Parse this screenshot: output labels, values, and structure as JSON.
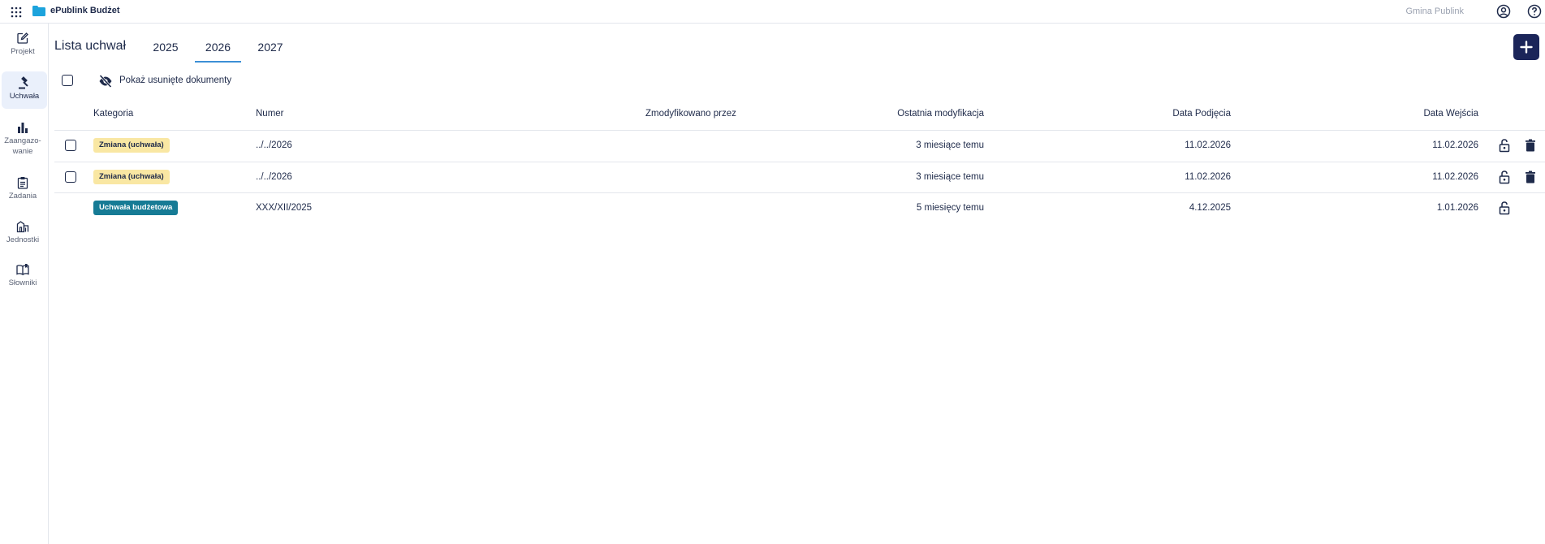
{
  "app": {
    "name": "ePublink Budżet",
    "org": "Gmina Publink"
  },
  "sidebar": {
    "items": [
      {
        "label": "Projekt"
      },
      {
        "label": "Uchwała"
      },
      {
        "label_line1": "Zaangazo-",
        "label_line2": "wanie"
      },
      {
        "label": "Zadania"
      },
      {
        "label": "Jednostki"
      },
      {
        "label": "Słowniki"
      }
    ]
  },
  "header": {
    "title": "Lista uchwał",
    "tabs": [
      {
        "label": "2025"
      },
      {
        "label": "2026",
        "active": true
      },
      {
        "label": "2027"
      }
    ]
  },
  "toolbar": {
    "show_deleted_label": "Pokaż usunięte dokumenty"
  },
  "table": {
    "columns": {
      "kategoria": "Kategoria",
      "numer": "Numer",
      "zmodyfikowano": "Zmodyfikowano przez",
      "ostatnia": "Ostatnia modyfikacja",
      "data_podjecia": "Data Podjęcia",
      "data_wejscia": "Data Wejścia"
    },
    "rows": [
      {
        "kategoria": "Zmiana (uchwała)",
        "numer": "../../2026",
        "zmodyfikowano": "",
        "ostatnia": "3 miesiące temu",
        "data_podjecia": "11.02.2026",
        "data_wejscia": "11.02.2026",
        "deletable": true
      },
      {
        "kategoria": "Zmiana (uchwała)",
        "numer": "../../2026",
        "zmodyfikowano": "",
        "ostatnia": "3 miesiące temu",
        "data_podjecia": "11.02.2026",
        "data_wejscia": "11.02.2026",
        "deletable": true
      },
      {
        "kategoria": "Uchwała budżetowa",
        "numer": "XXX/XII/2025",
        "zmodyfikowano": "",
        "ostatnia": "5 miesięcy temu",
        "data_podjecia": "4.12.2025",
        "data_wejscia": "1.01.2026",
        "deletable": false
      }
    ]
  },
  "colors": {
    "accent": "#1b2559",
    "tab_underline": "#3c8fd6",
    "badge_change": "#f9e7a3",
    "badge_budget": "#167b95",
    "logo": "#1ca3dc"
  },
  "icons": {
    "apps": "grid-icon",
    "logo": "folder-icon",
    "user": "user-circle-icon",
    "help": "help-icon",
    "add": "plus-icon",
    "hide": "eye-off-icon",
    "unlock": "unlock-icon",
    "delete": "trash-icon"
  }
}
